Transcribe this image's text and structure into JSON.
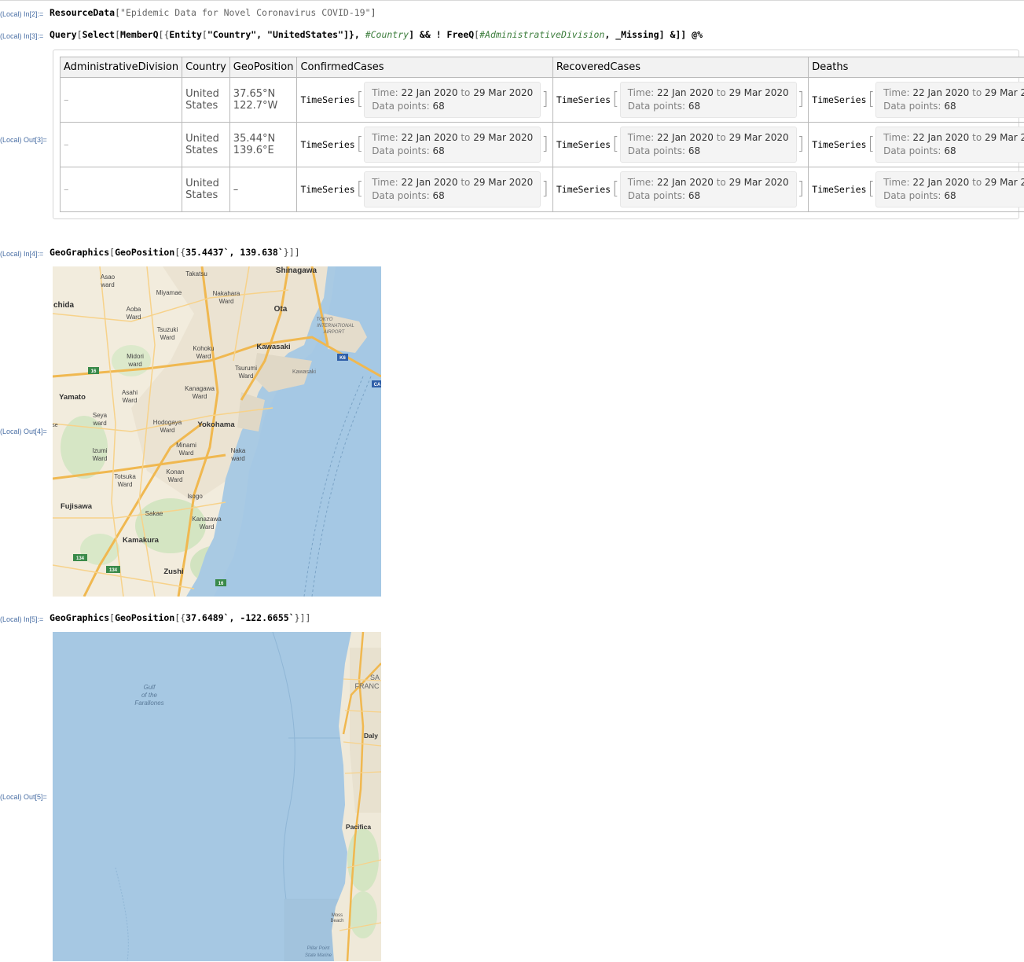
{
  "cells": {
    "in2": {
      "label": "(Local) In[2]:=",
      "fn": "ResourceData",
      "arg": "\"Epidemic Data for Novel Coronavirus COVID-19\""
    },
    "in3": {
      "label": "(Local) In[3]:=",
      "p1": "Query",
      "p2": "[",
      "p3": "Select",
      "p4": "[",
      "p5": "MemberQ",
      "p6": "[{",
      "p7": "Entity",
      "p8": "[",
      "p9": "\"Country\"",
      "p10": ", ",
      "p11": "\"UnitedStates\"",
      "p12": "]},",
      "p13": "#Country",
      "p14": "] && ! ",
      "p15": "FreeQ",
      "p16": "[",
      "p17": "#AdministrativeDivision",
      "p18": ", ",
      "p19": "_Missing",
      "p20": "] &]] @%"
    },
    "out3": {
      "label": "(Local) Out[3]="
    },
    "in4": {
      "label": "(Local) In[4]:=",
      "p1": "GeoGraphics",
      "p2": "[",
      "p3": "GeoPosition",
      "p4": "[{",
      "p5": "35.4437`",
      "p6": ", ",
      "p7": "139.638`",
      "p8": "}]]"
    },
    "out4": {
      "label": "(Local) Out[4]="
    },
    "in5": {
      "label": "(Local) In[5]:=",
      "p1": "GeoGraphics",
      "p2": "[",
      "p3": "GeoPosition",
      "p4": "[{",
      "p5": "37.6489`",
      "p6": ", ",
      "p7": "-122.6655`",
      "p8": "}]]"
    },
    "out5": {
      "label": "(Local) Out[5]="
    }
  },
  "table": {
    "headers": [
      "AdministrativeDivision",
      "Country",
      "GeoPosition",
      "ConfirmedCases",
      "RecoveredCases",
      "Deaths"
    ],
    "missing_glyph": "–",
    "ts_head": "TimeSeries",
    "ts_time_key": "Time:",
    "ts_from": "22 Jan 2020",
    "ts_to_word": "to",
    "ts_to": "29 Mar 2020",
    "ts_points_key": "Data points:",
    "ts_points": "68",
    "rows": [
      {
        "country": "United States",
        "geo": "37.65°N 122.7°W"
      },
      {
        "country": "United States",
        "geo": "35.44°N 139.6°E"
      },
      {
        "country": "United States",
        "geo": "–"
      }
    ]
  },
  "map_yokohama": {
    "labels": {
      "shinagawa": "Shinagawa",
      "asao": "Asao",
      "ward1": "ward",
      "takatsu": "Takatsu",
      "miyamae": "Miyamae",
      "nakahara": "Nakahara",
      "ward2": "Ward",
      "chida": "chida",
      "aoba": "Aoba",
      "ward3": "Ward",
      "ota": "Ota",
      "tokyo": "TOKYO",
      "intl": "INTERNATIONAL",
      "airport": "AIRPORT",
      "tsuzuki": "Tsuzuki",
      "ward4": "Ward",
      "kohoku": "Kohoku",
      "ward5": "Ward",
      "kawasaki": "Kawasaki",
      "midori": "Midori",
      "ward6": "ward",
      "tsurumi": "Tsurumi",
      "ward7": "Ward",
      "kawasaki2": "Kawasaki",
      "yamato": "Yamato",
      "asahi": "Asahi",
      "ward8": "Ward",
      "kanagawa": "Kanagawa",
      "ward9": "Ward",
      "seya": "Seya",
      "ward10": "ward",
      "hodogaya": "Hodogaya",
      "ward11": "Ward",
      "yokohama": "Yokohama",
      "izumi": "Izumi",
      "ward12": "Ward",
      "minami": "Minami",
      "ward13": "Ward",
      "naka": "Naka",
      "ward14": "ward",
      "totsuka": "Totsuka",
      "ward15": "Ward",
      "konan": "Konan",
      "ward16": "Ward",
      "isogo": "Isogo",
      "fujisawa": "Fujisawa",
      "sakae": "Sakae",
      "kanazawa": "Kanazawa",
      "ward17": "Ward",
      "kamakura": "Kamakura",
      "zushi": "Zushi",
      "se": "se"
    },
    "shields": {
      "r16a": "16",
      "r16b": "16",
      "k6": "K6",
      "ca": "CA",
      "r134a": "134",
      "r134b": "134"
    }
  },
  "map_sf": {
    "labels": {
      "gulf1": "Gulf",
      "gulf2": "of the",
      "gulf3": "Farallones",
      "sa": "SA",
      "franc": "FRANC",
      "daly": "Daly",
      "pacifica": "Pacifica",
      "moss1": "Moss",
      "moss2": "Beach",
      "pt1": "Pillar Point",
      "pt2": "State Marine"
    }
  }
}
